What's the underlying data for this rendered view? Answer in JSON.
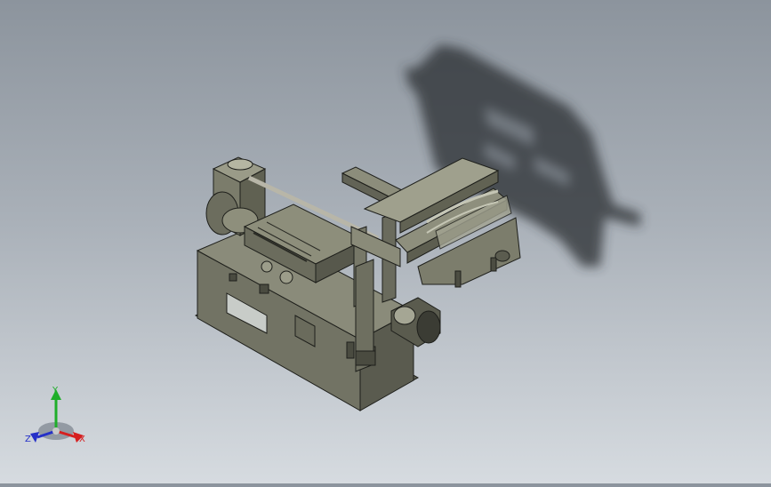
{
  "viewport": {
    "background_top": "#8c949d",
    "background_bottom": "#d6dbe0",
    "model_color": "#6f705f",
    "shadow_color": "#2a2e33"
  },
  "triad": {
    "x_label": "X",
    "y_label": "Y",
    "z_label": "Z",
    "x_color": "#d61f1f",
    "y_color": "#1fae2a",
    "z_color": "#2530c8"
  }
}
